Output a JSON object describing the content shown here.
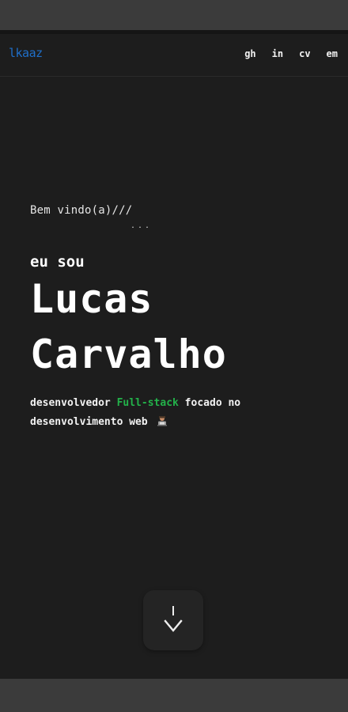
{
  "navbar": {
    "logo": "lkaaz",
    "links": [
      {
        "label": "gh"
      },
      {
        "label": "in"
      },
      {
        "label": "cv"
      },
      {
        "label": "em"
      }
    ]
  },
  "hero": {
    "welcome": "Bem vindo(a)///",
    "cursor": "...",
    "intro": "eu sou",
    "name_first": "Lucas",
    "name_last": "Carvalho",
    "desc_prefix": "desenvolvedor ",
    "desc_highlight": "Full-stack",
    "desc_suffix": " focado no desenvolvimento web",
    "emoji_icon": "technologist-icon"
  },
  "scroll_button": {
    "icon": "scroll-down-icon"
  },
  "colors": {
    "background": "#1d1d1d",
    "logo": "#1f6fc9",
    "highlight": "#23b24a",
    "text": "#f0f0f0"
  }
}
